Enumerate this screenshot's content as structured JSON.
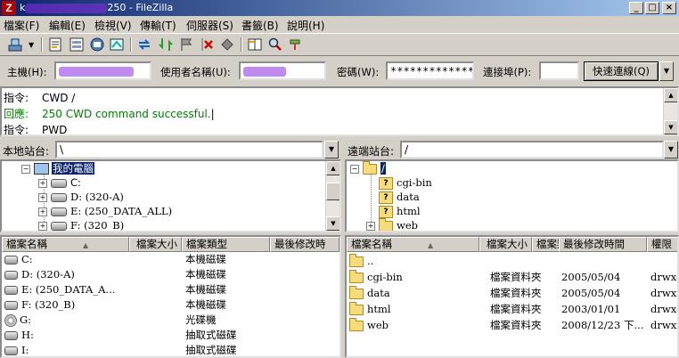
{
  "window": {
    "title_suffix": "250 - FileZilla",
    "title_prefix": "k"
  },
  "menu": [
    "檔案(F)",
    "編輯(E)",
    "檢視(V)",
    "傳輸(T)",
    "伺服器(S)",
    "書籤(B)",
    "說明(H)"
  ],
  "quickconnect": {
    "host_label": "主機(H):",
    "user_label": "使用者名稱(U):",
    "password_label": "密碼(W):",
    "password_value": "*************",
    "port_label": "連接埠(P):",
    "port_value": "",
    "connect_button": "快速連線(Q)"
  },
  "log": [
    {
      "label": "指令:",
      "text": "CWD /",
      "type": "command"
    },
    {
      "label": "回應:",
      "text": "250 CWD command successful.",
      "type": "response"
    },
    {
      "label": "指令:",
      "text": "PWD",
      "type": "command"
    }
  ],
  "local": {
    "site_label": "本地站台:",
    "path": "\\",
    "tree": {
      "root": "我的電腦",
      "drives": [
        "C:",
        "D: (320-A)",
        "E: (250_DATA_ALL)",
        "F: (320_B)"
      ]
    },
    "columns": [
      "檔案名稱",
      "檔案大小",
      "檔案類型",
      "最後修改時"
    ],
    "files": [
      {
        "name": "C:",
        "type": "本機磁碟",
        "icon": "drive"
      },
      {
        "name": "D: (320-A)",
        "type": "本機磁碟",
        "icon": "drive"
      },
      {
        "name": "E: (250_DATA_A...",
        "type": "本機磁碟",
        "icon": "drive"
      },
      {
        "name": "F: (320_B)",
        "type": "本機磁碟",
        "icon": "drive"
      },
      {
        "name": "G:",
        "type": "光碟機",
        "icon": "cdrom"
      },
      {
        "name": "H:",
        "type": "抽取式磁碟",
        "icon": "drive"
      },
      {
        "name": "I:",
        "type": "抽取式磁碟",
        "icon": "drive"
      }
    ]
  },
  "remote": {
    "site_label": "遠端站台:",
    "path": "/",
    "tree": {
      "root": "/",
      "children": [
        "cgi-bin",
        "data",
        "html",
        "web"
      ]
    },
    "columns": [
      "檔案名稱",
      "檔案大小",
      "檔案類型",
      "最後修改時間",
      "權限"
    ],
    "files": [
      {
        "name": "..",
        "size": "",
        "type": "",
        "modified": "",
        "perms": ""
      },
      {
        "name": "cgi-bin",
        "size": "",
        "type": "檔案資料夾",
        "modified": "2005/05/04",
        "perms": "drwx-"
      },
      {
        "name": "data",
        "size": "",
        "type": "檔案資料夾",
        "modified": "2005/05/04",
        "perms": "drwxr-"
      },
      {
        "name": "html",
        "size": "",
        "type": "檔案資料夾",
        "modified": "2003/01/01",
        "perms": "drwx-"
      },
      {
        "name": "web",
        "size": "",
        "type": "檔案資料夾",
        "modified": "2008/12/23 下...",
        "perms": "drwxr-"
      }
    ]
  }
}
